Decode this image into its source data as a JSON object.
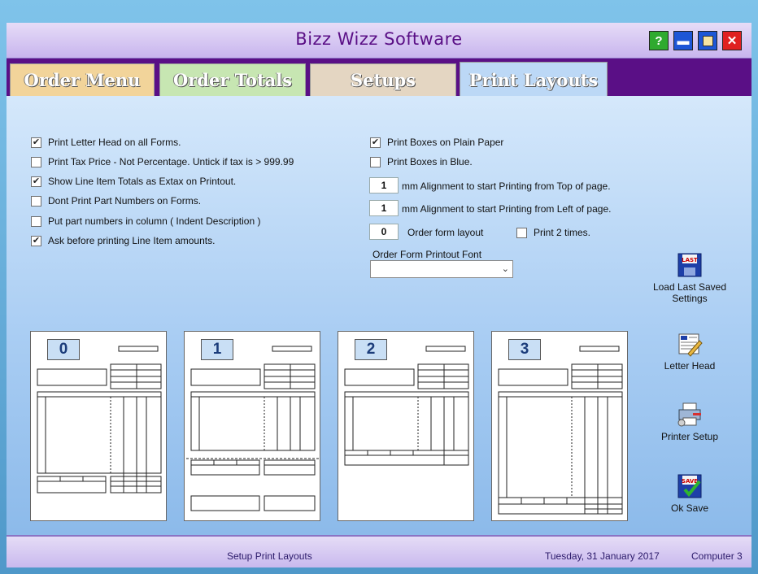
{
  "window": {
    "title": "Bizz Wizz Software",
    "help_glyph": "?",
    "min_glyph": "▬",
    "max_glyph": "▢",
    "close_glyph": "✕"
  },
  "tabs": [
    {
      "label": "Order Menu",
      "color": "#f2d49a"
    },
    {
      "label": "Order Totals",
      "color": "#c7e6b2"
    },
    {
      "label": "Setups",
      "color": "#e4d6c2"
    },
    {
      "label": "Print Layouts",
      "color": "#bcd8f6",
      "active": true
    }
  ],
  "left_options": [
    {
      "label": "Print Letter Head on all Forms.",
      "checked": true
    },
    {
      "label": "Print Tax Price - Not Percentage.  Untick if tax is > 999.99",
      "checked": false
    },
    {
      "label": "Show Line Item Totals as Extax on Printout.",
      "checked": true
    },
    {
      "label": "Dont Print Part Numbers on Forms.",
      "checked": false
    },
    {
      "label": "Put part numbers in column ( Indent Description )",
      "checked": false
    },
    {
      "label": "Ask before printing Line Item amounts.",
      "checked": true
    }
  ],
  "right_options": {
    "plain_paper": {
      "label": "Print Boxes on Plain Paper",
      "checked": true
    },
    "blue_boxes": {
      "label": "Print Boxes in Blue.",
      "checked": false
    },
    "top_align": {
      "value": "1",
      "label": "mm  Alignment to start Printing from Top of page."
    },
    "left_align": {
      "value": "1",
      "label": "mm  Alignment to start Printing from Left of page."
    },
    "layout": {
      "value": "0",
      "label": "Order form layout"
    },
    "print_twice": {
      "label": "Print 2 times.",
      "checked": false
    },
    "font_label": "Order Form Printout Font",
    "font_value": ""
  },
  "layouts": [
    "0",
    "1",
    "2",
    "3"
  ],
  "actions": {
    "load_last": "Load Last Saved Settings",
    "letter_head": "Letter Head",
    "printer_setup": "Printer Setup",
    "ok_save": "Ok Save",
    "load_icon": "floppy-disk-last-icon",
    "letter_icon": "letterhead-pencil-icon",
    "printer_icon": "printer-setup-icon",
    "save_icon": "floppy-disk-save-icon"
  },
  "status": {
    "section": "Setup Print Layouts",
    "date": "Tuesday, 31 January 2017",
    "computer": "Computer 3"
  }
}
